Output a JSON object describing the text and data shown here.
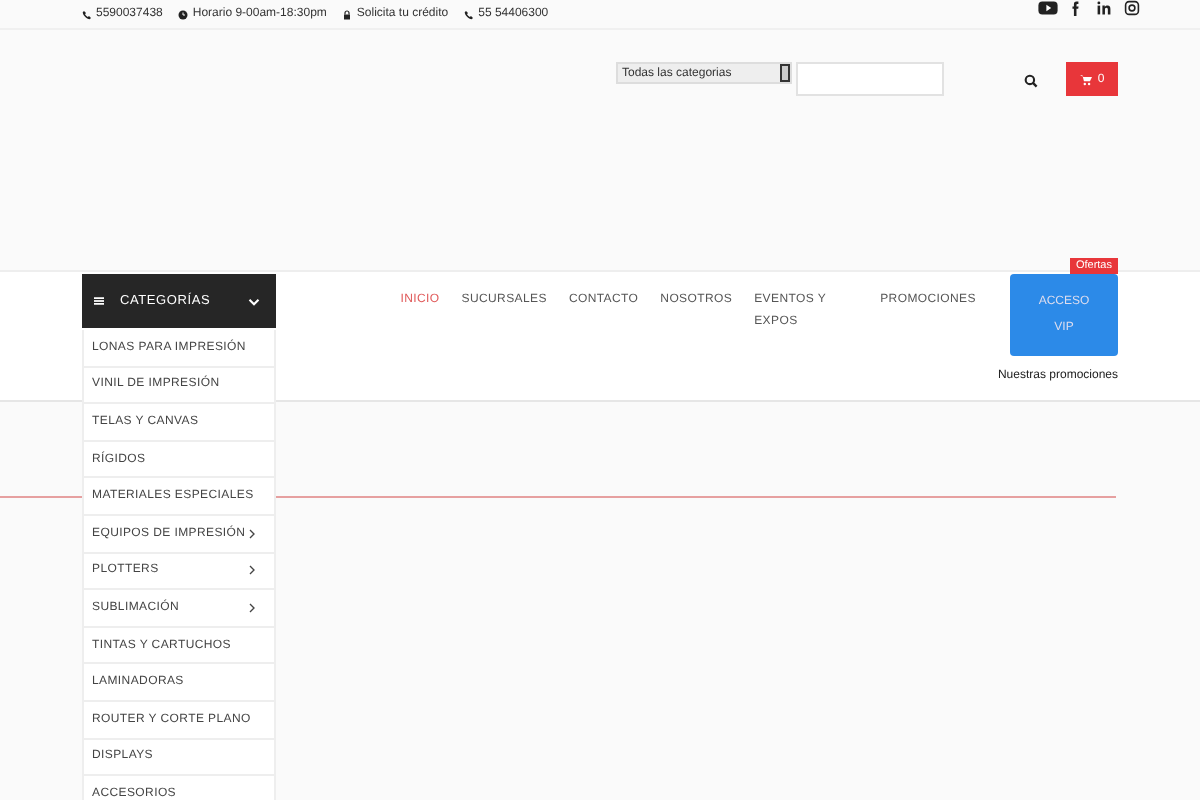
{
  "topbar": {
    "contacts": [
      {
        "kind": "phone",
        "text": "5590037438"
      },
      {
        "kind": "clock",
        "text": "Horario 9-00am-18:30pm"
      },
      {
        "kind": "lock",
        "text": "Solicita tu crédito"
      },
      {
        "kind": "phone",
        "text": "55 54406300"
      }
    ],
    "social": [
      {
        "kind": "youtube"
      },
      {
        "kind": "facebook"
      },
      {
        "kind": "linkedin"
      },
      {
        "kind": "instagram"
      }
    ]
  },
  "search": {
    "category": "Todas las categorias"
  },
  "cart": {
    "count": "0"
  },
  "categories": {
    "title": "CATEGORÍAS",
    "expanded": true,
    "items": [
      {
        "label": "LONAS PARA IMPRESIÓN",
        "has_submenu": false
      },
      {
        "label": "VINIL DE IMPRESIÓN",
        "has_submenu": false
      },
      {
        "label": "TELAS Y CANVAS",
        "has_submenu": false
      },
      {
        "label": "RÍGIDOS",
        "has_submenu": false
      },
      {
        "label": "MATERIALES ESPECIALES",
        "has_submenu": false
      },
      {
        "label": "EQUIPOS DE IMPRESIÓN",
        "has_submenu": true
      },
      {
        "label": "PLOTTERS",
        "has_submenu": true
      },
      {
        "label": "SUBLIMACIÓN",
        "has_submenu": true
      },
      {
        "label": "TINTAS Y CARTUCHOS",
        "has_submenu": false
      },
      {
        "label": "LAMINADORAS",
        "has_submenu": false
      },
      {
        "label": "ROUTER Y CORTE PLANO",
        "has_submenu": false
      },
      {
        "label": "DISPLAYS",
        "has_submenu": false
      },
      {
        "label": "ACCESORIOS",
        "has_submenu": false
      }
    ]
  },
  "nav": [
    {
      "kind": "link",
      "label": "INICIO",
      "selected": true
    },
    {
      "kind": "link",
      "label": "SUCURSALES",
      "selected": false
    },
    {
      "kind": "link",
      "label": "CONTACTO",
      "selected": false
    },
    {
      "kind": "link",
      "label": "NOSOTROS",
      "selected": false
    },
    {
      "kind": "link",
      "label": "EVENTOS Y EXPOS",
      "selected": false
    },
    {
      "kind": "link",
      "label": "PROMOCIONES",
      "selected": false
    },
    {
      "kind": "button",
      "label": "ACCESO VIP",
      "badge": "Ofertas",
      "caption": "Nuestras promociones",
      "selected": false
    }
  ]
}
